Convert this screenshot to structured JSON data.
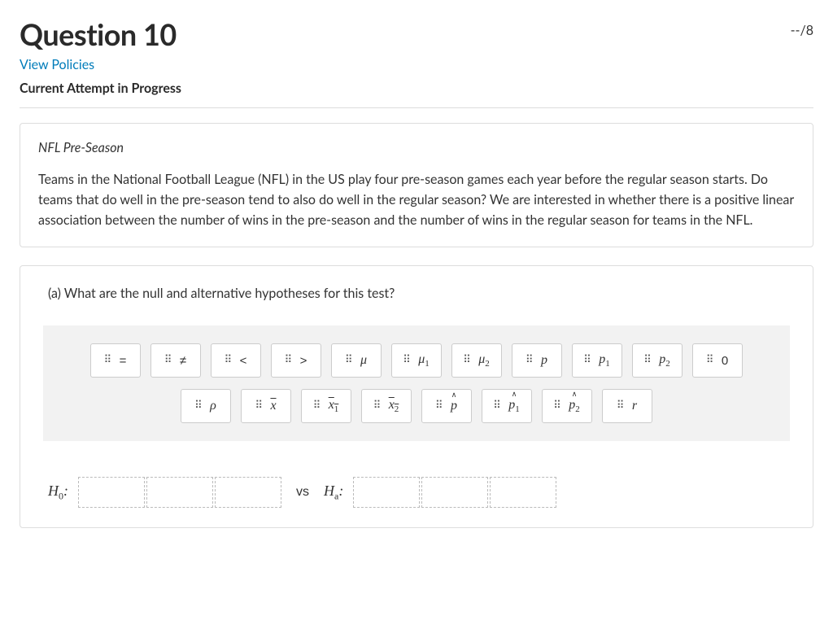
{
  "header": {
    "title": "Question 10",
    "points": "--/8",
    "policies_link": "View Policies",
    "status": "Current Attempt in Progress"
  },
  "prompt": {
    "subtitle": "NFL Pre-Season",
    "body": "Teams in the National Football League (NFL) in the US play four pre-season games each year before the regular season starts. Do teams that do well in the pre-season tend to also do well in the regular season? We are interested in whether there is a positive linear association between the number of wins in the pre-season and the number of wins in the regular season for teams in the NFL."
  },
  "part_a": {
    "label": "(a) What are the null and alternative hypotheses for this test?"
  },
  "chips_row1": [
    {
      "id": "eq",
      "type": "plain",
      "text": "="
    },
    {
      "id": "neq",
      "type": "plain",
      "text": "≠"
    },
    {
      "id": "lt",
      "type": "plain",
      "text": "<"
    },
    {
      "id": "gt",
      "type": "plain",
      "text": ">"
    },
    {
      "id": "mu",
      "type": "sym",
      "text": "μ"
    },
    {
      "id": "mu1",
      "type": "sym-sub",
      "text": "μ",
      "sub": "1"
    },
    {
      "id": "mu2",
      "type": "sym-sub",
      "text": "μ",
      "sub": "2"
    },
    {
      "id": "p",
      "type": "sym",
      "text": "p"
    },
    {
      "id": "p1",
      "type": "sym-sub",
      "text": "p",
      "sub": "1"
    },
    {
      "id": "p2",
      "type": "sym-sub",
      "text": "p",
      "sub": "2"
    },
    {
      "id": "zero",
      "type": "zero",
      "text": "0"
    }
  ],
  "chips_row2": [
    {
      "id": "rho",
      "type": "sym",
      "text": "ρ"
    },
    {
      "id": "xbar",
      "type": "bar",
      "text": "x"
    },
    {
      "id": "xbar1",
      "type": "bar-sub",
      "text": "x",
      "sub": "1"
    },
    {
      "id": "xbar2",
      "type": "bar-sub",
      "text": "x",
      "sub": "2"
    },
    {
      "id": "phat",
      "type": "hat",
      "text": "p"
    },
    {
      "id": "phat1",
      "type": "hat-sub",
      "text": "p",
      "sub": "1"
    },
    {
      "id": "phat2",
      "type": "hat-sub",
      "text": "p",
      "sub": "2"
    },
    {
      "id": "r",
      "type": "sym",
      "text": "r"
    }
  ],
  "answer": {
    "h0_label": "H",
    "h0_sub": "0",
    "h0_colon": ":",
    "vs": "vs",
    "ha_label": "H",
    "ha_sub": "a",
    "ha_colon": ":"
  }
}
